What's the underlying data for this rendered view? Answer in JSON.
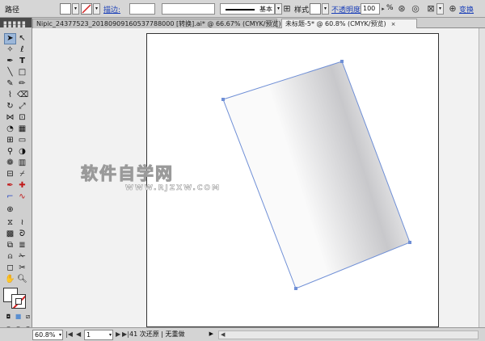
{
  "control_bar": {
    "label": "路径",
    "stroke_link": "描边:",
    "stroke_profile": "基本",
    "style_label": "样式:",
    "opacity_link": "不透明度:",
    "opacity_value": "100",
    "opacity_unit": "%",
    "transform_link": "变换"
  },
  "tabs": [
    {
      "label": "Nipic_24377523_20180909160537788000 [转换].ai* @ 66.67% (CMYK/预览)",
      "active": false
    },
    {
      "label": "未标题-5* @ 60.8% (CMYK/预览)",
      "active": true
    }
  ],
  "tab_close_glyph": "×",
  "canvas": {
    "watermark": "软件自学网",
    "watermark_url": "WWW.RJZXW.COM"
  },
  "status_bar": {
    "zoom": "60.8%",
    "first_glyph": "|◀",
    "prev_glyph": "◀",
    "page": "1",
    "next_glyph": "▶",
    "last_glyph": "▶|",
    "info": "41 次还原 | 无重做",
    "info_arrow": "▶",
    "scroll_left": "◀"
  },
  "colors": {
    "selection_blue": "#6f8fd6",
    "gradient_light": "#fafafa",
    "gradient_dark": "#c8c8cb"
  },
  "icons": {
    "selection": "selection-tool-icon",
    "direct_selection": "direct-selection-tool-icon",
    "pen": "pen-tool-icon",
    "type": "type-tool-icon",
    "zoom": "zoom-tool-icon",
    "hand": "hand-tool-icon"
  }
}
